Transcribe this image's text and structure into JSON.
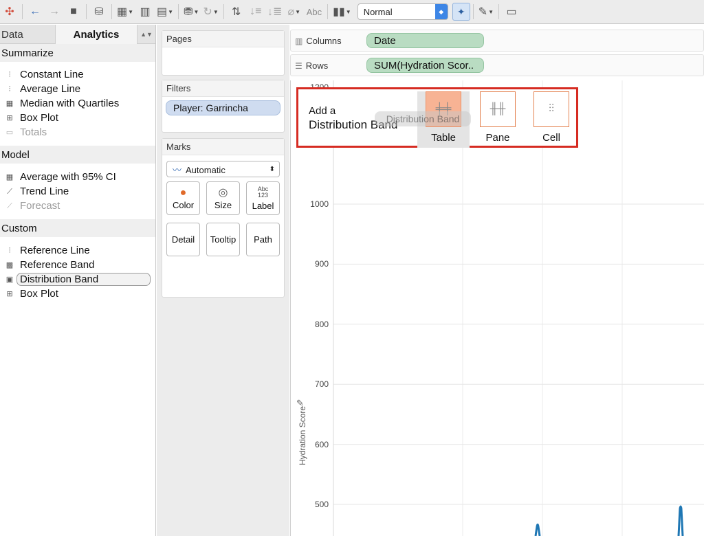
{
  "toolbar": {
    "fit_value": "Normal",
    "abc_label": "Abc",
    "icons": [
      "tableau-logo-icon",
      "undo-icon",
      "redo-icon",
      "save-icon",
      "new-datasource-icon",
      "new-worksheet-icon",
      "duplicate-sheet-icon",
      "clear-sheet-icon",
      "data-icon",
      "refresh-icon",
      "swap-icon",
      "sort-ascending-icon",
      "sort-descending-icon",
      "group-icon",
      "show-labels-icon",
      "show-me-icon",
      "pin-icon",
      "highlight-icon",
      "presentation-icon"
    ]
  },
  "left_pane": {
    "tabs": {
      "data": "Data",
      "analytics": "Analytics"
    },
    "sections": [
      {
        "title": "Summarize",
        "items": [
          {
            "label": "Constant Line",
            "icon": "reference-line-icon",
            "enabled": true
          },
          {
            "label": "Average Line",
            "icon": "reference-line-icon",
            "enabled": true
          },
          {
            "label": "Median with Quartiles",
            "icon": "distribution-icon",
            "enabled": true
          },
          {
            "label": "Box Plot",
            "icon": "box-plot-icon",
            "enabled": true
          },
          {
            "label": "Totals",
            "icon": "totals-icon",
            "enabled": false
          }
        ]
      },
      {
        "title": "Model",
        "items": [
          {
            "label": "Average with 95% CI",
            "icon": "distribution-icon",
            "enabled": true
          },
          {
            "label": "Trend Line",
            "icon": "trend-line-icon",
            "enabled": true
          },
          {
            "label": "Forecast",
            "icon": "forecast-icon",
            "enabled": false
          }
        ]
      },
      {
        "title": "Custom",
        "items": [
          {
            "label": "Reference Line",
            "icon": "reference-line-icon",
            "enabled": true
          },
          {
            "label": "Reference Band",
            "icon": "reference-band-icon",
            "enabled": true
          },
          {
            "label": "Distribution Band",
            "icon": "distribution-band-icon",
            "enabled": true,
            "selected": true
          },
          {
            "label": "Box Plot",
            "icon": "box-plot-icon",
            "enabled": true
          }
        ]
      }
    ]
  },
  "cards": {
    "pages": {
      "title": "Pages"
    },
    "filters": {
      "title": "Filters",
      "pill": "Player: Garrincha"
    },
    "marks": {
      "title": "Marks",
      "type": "Automatic",
      "buttons": {
        "color": "Color",
        "size": "Size",
        "label": "Label",
        "label_glyph_top": "Abc",
        "label_glyph_bottom": "123",
        "detail": "Detail",
        "tooltip": "Tooltip",
        "path": "Path"
      }
    }
  },
  "shelves": {
    "columns": {
      "label": "Columns",
      "pill": "Date"
    },
    "rows": {
      "label": "Rows",
      "pill": "SUM(Hydration Scor.."
    }
  },
  "chart_data": {
    "type": "line",
    "ylabel": "Hydration Score",
    "y_ticks": [
      "1000",
      "900",
      "800",
      "700",
      "600",
      "500"
    ],
    "y_tick_values": [
      1000,
      900,
      800,
      700,
      600,
      500
    ],
    "top_tick_partial": "1200",
    "series": [
      {
        "color": "#1f77b4"
      }
    ],
    "visible_peaks": [
      470,
      500
    ],
    "grid": true
  },
  "popup": {
    "line1": "Add a",
    "line2": "Distribution Band",
    "drag_label": "Distribution Band",
    "zones": [
      {
        "label": "Table",
        "active": true
      },
      {
        "label": "Pane",
        "active": false
      },
      {
        "label": "Cell",
        "active": false
      }
    ]
  }
}
